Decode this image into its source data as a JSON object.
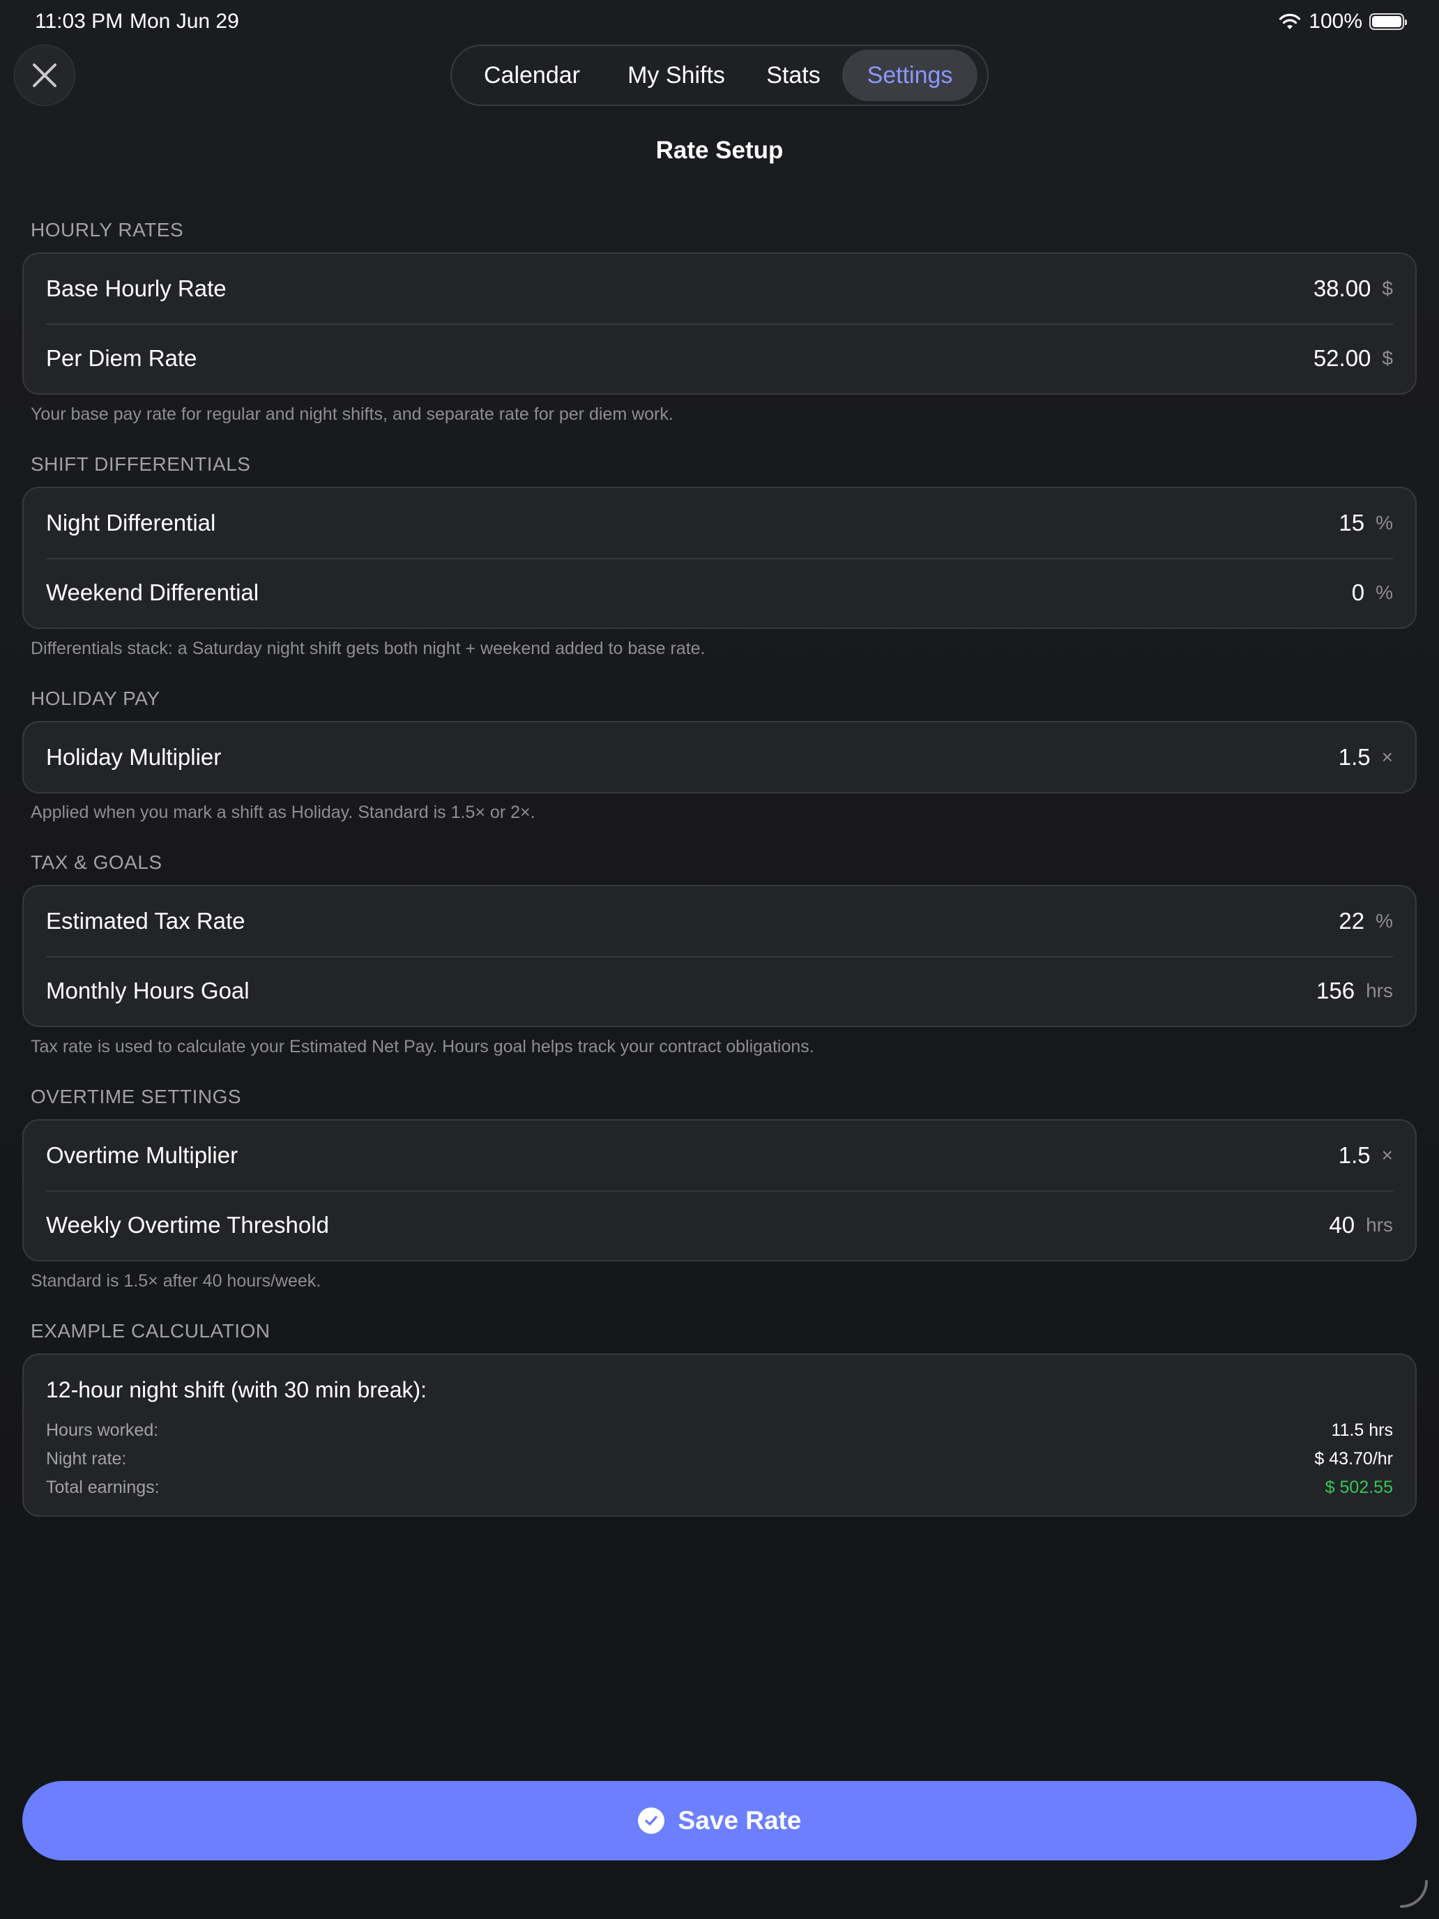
{
  "status_bar": {
    "time": "11:03 PM",
    "date": "Mon Jun 29",
    "battery": "100%"
  },
  "tabs": [
    {
      "label": "Calendar"
    },
    {
      "label": "My Shifts"
    },
    {
      "label": "Stats"
    },
    {
      "label": "Settings",
      "selected": true
    }
  ],
  "page_title": "Rate Setup",
  "sections": {
    "hourly": {
      "header": "HOURLY RATES",
      "rows": [
        {
          "label": "Base Hourly Rate",
          "value": "38.00",
          "unit": "$"
        },
        {
          "label": "Per Diem Rate",
          "value": "52.00",
          "unit": "$"
        }
      ],
      "footer": "Your base pay rate for regular and night shifts, and separate rate for per diem work."
    },
    "differentials": {
      "header": "SHIFT DIFFERENTIALS",
      "rows": [
        {
          "label": "Night Differential",
          "value": "15",
          "unit": "%"
        },
        {
          "label": "Weekend Differential",
          "value": "0",
          "unit": "%"
        }
      ],
      "footer": "Differentials stack: a Saturday night shift gets both night + weekend added to base rate."
    },
    "holiday": {
      "header": "HOLIDAY PAY",
      "rows": [
        {
          "label": "Holiday Multiplier",
          "value": "1.5",
          "unit": "×"
        }
      ],
      "footer": "Applied when you mark a shift as Holiday. Standard is 1.5× or 2×."
    },
    "tax": {
      "header": "TAX & GOALS",
      "rows": [
        {
          "label": "Estimated Tax Rate",
          "value": "22",
          "unit": "%"
        },
        {
          "label": "Monthly Hours Goal",
          "value": "156",
          "unit": "hrs"
        }
      ],
      "footer": "Tax rate is used to calculate your Estimated Net Pay. Hours goal helps track your contract obligations."
    },
    "overtime": {
      "header": "OVERTIME SETTINGS",
      "rows": [
        {
          "label": "Overtime Multiplier",
          "value": "1.5",
          "unit": "×"
        },
        {
          "label": "Weekly Overtime Threshold",
          "value": "40",
          "unit": "hrs"
        }
      ],
      "footer": "Standard is 1.5× after 40 hours/week."
    },
    "example": {
      "header": "EXAMPLE CALCULATION",
      "title": "12-hour night shift (with 30 min break):",
      "rows": [
        {
          "label": "Hours worked:",
          "value": "11.5 hrs"
        },
        {
          "label": "Night rate:",
          "value": "$ 43.70/hr"
        },
        {
          "label": "Total earnings:",
          "value": "$ 502.55"
        }
      ]
    }
  },
  "save_button": {
    "label": "Save Rate"
  },
  "colors": {
    "accent": "#6b7fff",
    "selected_tab_text": "#8c97ff",
    "positive": "#34c759"
  }
}
